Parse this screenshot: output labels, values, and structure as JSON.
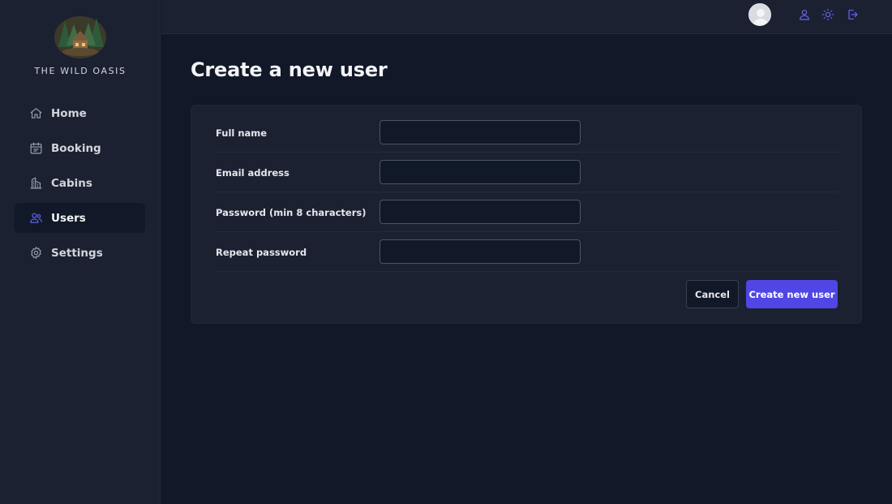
{
  "brand": {
    "name": "THE WILD OASIS"
  },
  "sidebar": {
    "items": [
      {
        "label": "Home",
        "icon": "home-icon",
        "active": false
      },
      {
        "label": "Booking",
        "icon": "calendar-icon",
        "active": false
      },
      {
        "label": "Cabins",
        "icon": "building-icon",
        "active": false
      },
      {
        "label": "Users",
        "icon": "users-icon",
        "active": true
      },
      {
        "label": "Settings",
        "icon": "gear-icon",
        "active": false
      }
    ]
  },
  "header": {
    "icons": [
      "avatar",
      "user-icon",
      "sun-icon",
      "logout-icon"
    ],
    "accent": "#4f46e5"
  },
  "main": {
    "title": "Create a new user",
    "form": {
      "fields": [
        {
          "label": "Full name",
          "value": "",
          "type": "text"
        },
        {
          "label": "Email address",
          "value": "",
          "type": "email"
        },
        {
          "label": "Password (min 8 characters)",
          "value": "",
          "type": "password"
        },
        {
          "label": "Repeat password",
          "value": "",
          "type": "password"
        }
      ],
      "cancel_label": "Cancel",
      "submit_label": "Create new user"
    }
  },
  "colors": {
    "background": "#111827",
    "panel": "#1b2131",
    "accent": "#4f46e5",
    "accent_light": "#6366f1"
  }
}
